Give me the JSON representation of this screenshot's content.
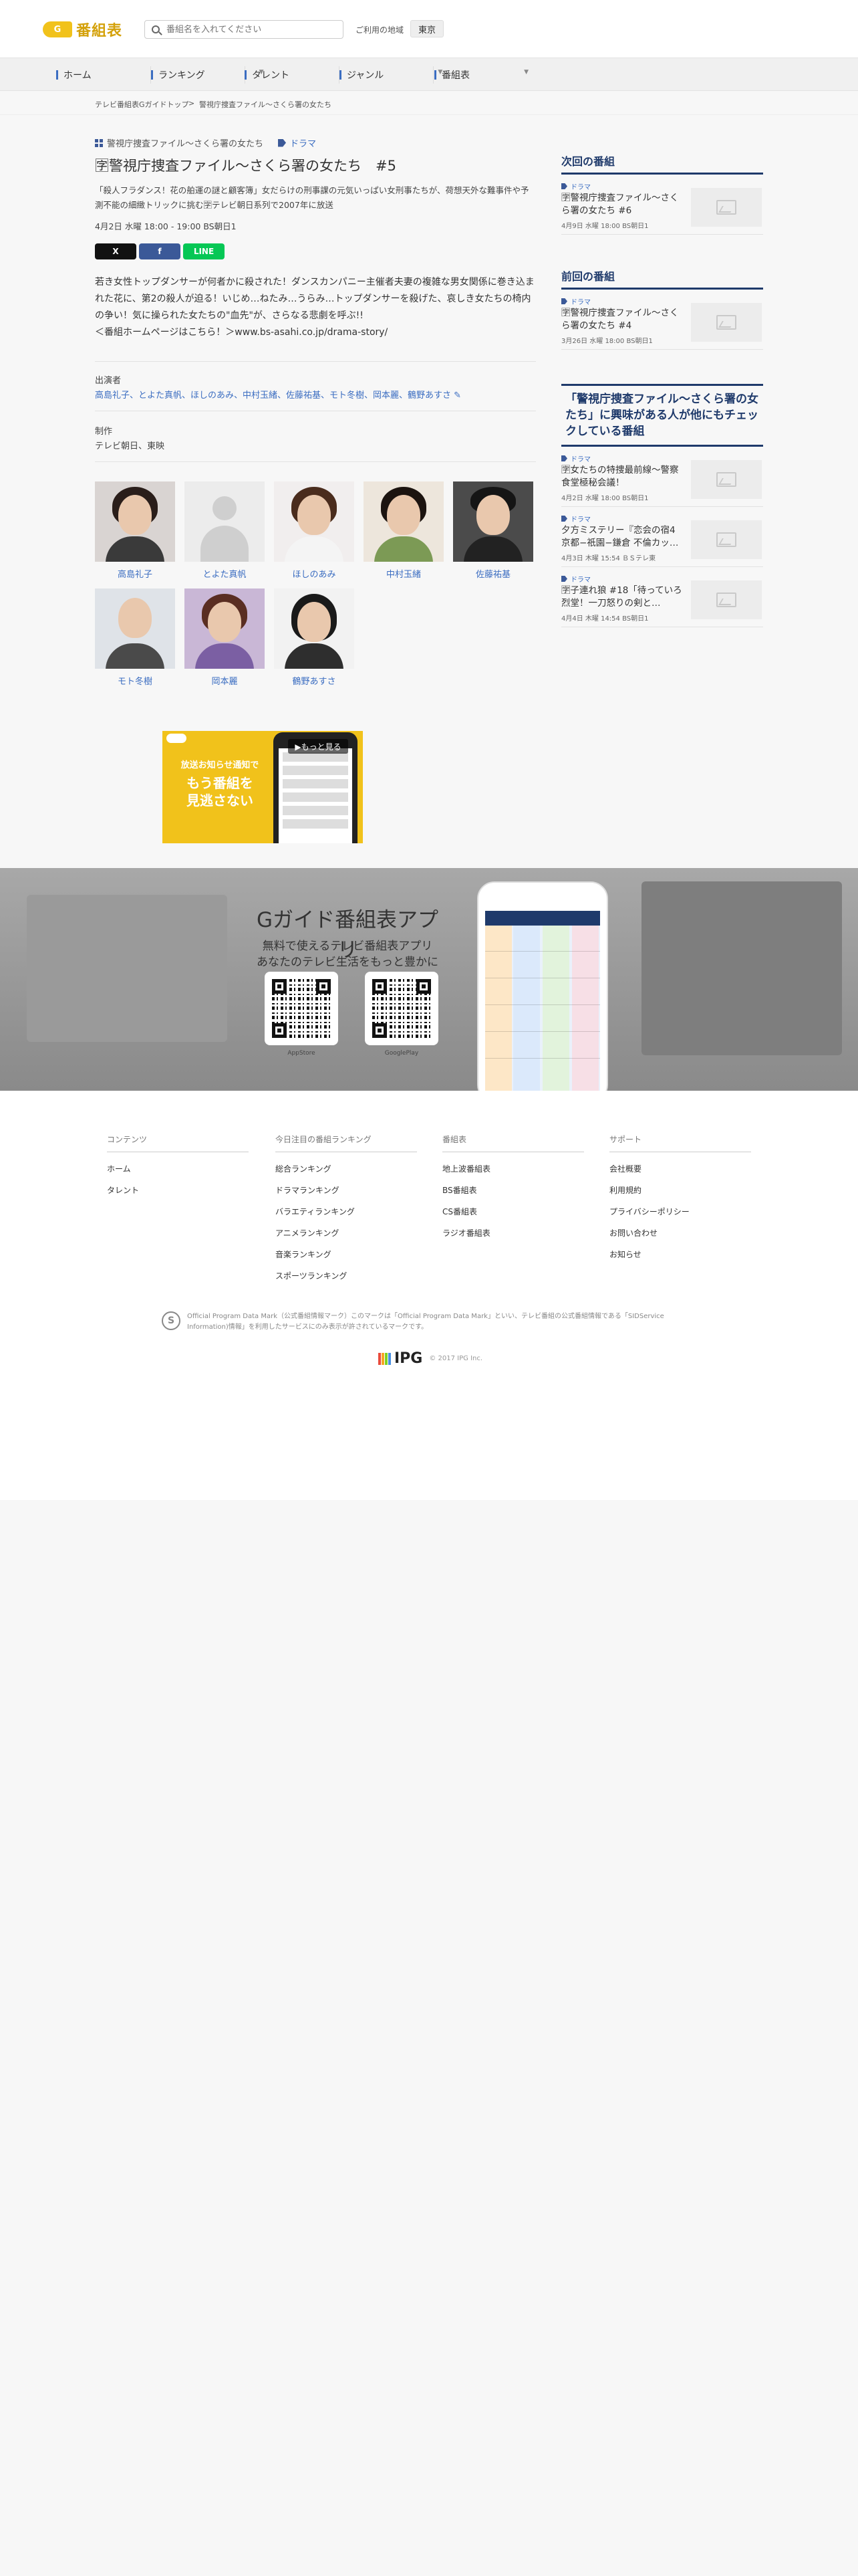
{
  "header": {
    "logo_mark": "G",
    "logo_text": "番組表",
    "search_placeholder": "番組名を入れてください",
    "region_label": "ご利用の地域",
    "region_value": "東京"
  },
  "nav": {
    "items": [
      "ホーム",
      "ランキング",
      "タレント",
      "ジャンル",
      "番組表"
    ]
  },
  "breadcrumb": {
    "items": [
      "テレビ番組表Gガイドトップ",
      ">",
      "警視庁捜査ファイル〜さくら署の女たち"
    ]
  },
  "program": {
    "category": "警視庁捜査ファイル〜さくら署の女たち",
    "genre": "ドラマ",
    "title": "🈑警視庁捜査ファイル〜さくら署の女たち　#5",
    "subtitle": "「殺人フラダンス！花の舶運の謎と顧客簿」女だらけの刑事課の元気いっぱい女刑事たちが、荷想天外な難事件や予測不能の細緻トリックに挑む🈑テレビ朝日系列で2007年に放送",
    "air_time": "4月2日 水曜 18:00 - 19:00 BS朝日1",
    "description": "若き女性トップダンサーが何者かに殺された！ダンスカンパニー主催者夫妻の複雑な男女関係に巻き込まれた花に、第2の殺人が迫る！いじめ…ねたみ…うらみ…トップダンサーを殺げた、哀しき女たちの椅内の争い！気に操られた女たちの\"血先\"が、さらなる悲劇を呼ぶ!!\n＜番組ホームページはこちら！＞www.bs-asahi.co.jp/drama-story/",
    "cast_label": "出演者",
    "cast_line": "高島礼子、とよた真帆、ほしのあみ、中村玉緒、佐藤祐基、モト冬樹、岡本麗、鶴野あすさ ✎",
    "production_label": "制作",
    "production": "テレビ朝日、東映"
  },
  "share": {
    "x": "X",
    "facebook": "f",
    "line": "LINE"
  },
  "cast": [
    {
      "name": "高島礼子"
    },
    {
      "name": "とよた真帆"
    },
    {
      "name": "ほしのあみ"
    },
    {
      "name": "中村玉緒"
    },
    {
      "name": "佐藤祐基"
    },
    {
      "name": "モト冬樹"
    },
    {
      "name": "岡本麗"
    },
    {
      "name": "鶴野あすさ"
    }
  ],
  "ad": {
    "more": "▶もっと見る",
    "small": "放送お知らせ通知で",
    "big1": "もう番組を",
    "big2": "見逃さない"
  },
  "sidebar": {
    "next": {
      "heading": "次回の番組",
      "items": [
        {
          "tag": "ドラマ",
          "title": "🈑警視庁捜査ファイル〜さくら署の女たち #6",
          "meta": "4月9日 水曜 18:00 BS朝日1"
        }
      ]
    },
    "prev": {
      "heading": "前回の番組",
      "items": [
        {
          "tag": "ドラマ",
          "title": "🈑警視庁捜査ファイル〜さくら署の女たち #4",
          "meta": "3月26日 水曜 18:00 BS朝日1"
        }
      ]
    },
    "related": {
      "heading": "「警視庁捜査ファイル〜さくら署の女たち」に興味がある人が他にもチェックしている番組",
      "items": [
        {
          "tag": "ドラマ",
          "title": "🈑女たちの特捜最前線〜警察食堂極秘会議！",
          "meta": "4月2日 水曜 18:00 BS朝日1"
        },
        {
          "tag": "ドラマ",
          "title": "夕方ミステリー『恋会の宿4 京都−祇園−鎌倉 不倫カッ…",
          "meta": "4月3日 木曜 15:54 ＢＳテレ東"
        },
        {
          "tag": "ドラマ",
          "title": "🈑子連れ狼 #18「待っていろ烈堂！一刀怒りの剣と…",
          "meta": "4月4日 木曜 14:54 BS朝日1"
        }
      ]
    }
  },
  "promo": {
    "title": "Gガイド番組表アプリ",
    "sub1": "無料で使えるテレビ番組表アプリ",
    "sub2": "あなたのテレビ生活をもっと豊かに",
    "qr1_label": "AppStore",
    "qr2_label": "GooglePlay"
  },
  "footer": {
    "columns": [
      {
        "heading": "コンテンツ",
        "links": [
          "ホーム",
          "タレント"
        ]
      },
      {
        "heading": "今日注目の番組ランキング",
        "links": [
          "総合ランキング",
          "ドラマランキング",
          "バラエティランキング",
          "アニメランキング",
          "音楽ランキング",
          "スポーツランキング"
        ]
      },
      {
        "heading": "番組表",
        "links": [
          "地上波番組表",
          "BS番組表",
          "CS番組表",
          "ラジオ番組表"
        ]
      },
      {
        "heading": "サポート",
        "links": [
          "会社概要",
          "利用規約",
          "プライバシーポリシー",
          "お問い合わせ",
          "お知らせ"
        ]
      }
    ],
    "official_icon": "S",
    "official_text": "Official Program Data Mark（公式番組情報マーク）このマークは「Official Program Data Mark」といい、テレビ番組の公式番組情報である「SIDService Information)情報」を利用したサービスにのみ表示が許されているマークです。",
    "ipg_text": "IPG",
    "copyright": "© 2017 IPG Inc."
  },
  "colors": {
    "accent": "#3b6dc1",
    "navy": "#1f3a6b",
    "logo_yellow": "#f1c21b",
    "line_green": "#06c755",
    "facebook_blue": "#3b5998"
  }
}
